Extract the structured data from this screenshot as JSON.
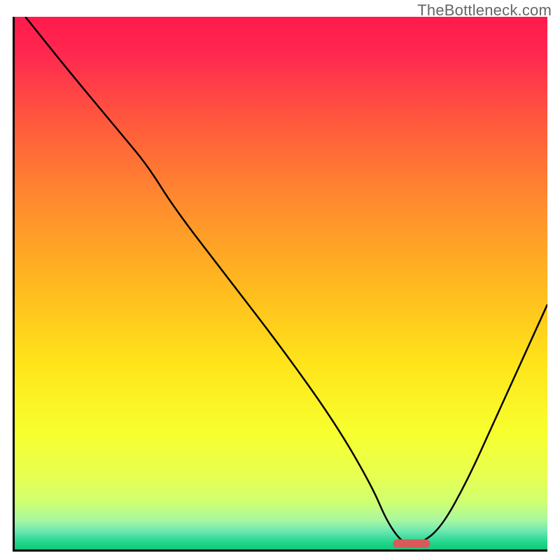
{
  "watermark": "TheBottleneck.com",
  "chart_data": {
    "type": "line",
    "title": "",
    "xlabel": "",
    "ylabel": "",
    "xlim": [
      0,
      100
    ],
    "ylim": [
      0,
      100
    ],
    "grid": false,
    "series": [
      {
        "name": "curve",
        "x": [
          2,
          10,
          20,
          25,
          30,
          40,
          50,
          60,
          67,
          70,
          73,
          76,
          80,
          85,
          90,
          95,
          100
        ],
        "values": [
          100,
          90,
          78,
          72,
          64,
          51,
          38,
          24,
          12,
          5,
          1,
          1,
          4,
          13,
          24,
          35,
          46
        ]
      }
    ],
    "optimal_marker": {
      "x_start": 71,
      "x_end": 78,
      "height": 1.6
    },
    "gradient_stops": [
      {
        "offset": 0.0,
        "color": "#ff1a4b"
      },
      {
        "offset": 0.07,
        "color": "#ff2850"
      },
      {
        "offset": 0.2,
        "color": "#ff5a3c"
      },
      {
        "offset": 0.35,
        "color": "#ff8c2e"
      },
      {
        "offset": 0.5,
        "color": "#ffb81f"
      },
      {
        "offset": 0.65,
        "color": "#ffe41a"
      },
      {
        "offset": 0.78,
        "color": "#f7ff2e"
      },
      {
        "offset": 0.86,
        "color": "#e8ff50"
      },
      {
        "offset": 0.91,
        "color": "#d0ff70"
      },
      {
        "offset": 0.945,
        "color": "#a8f7a0"
      },
      {
        "offset": 0.965,
        "color": "#6ee8b0"
      },
      {
        "offset": 0.985,
        "color": "#25d890"
      },
      {
        "offset": 1.0,
        "color": "#12c878"
      }
    ]
  }
}
